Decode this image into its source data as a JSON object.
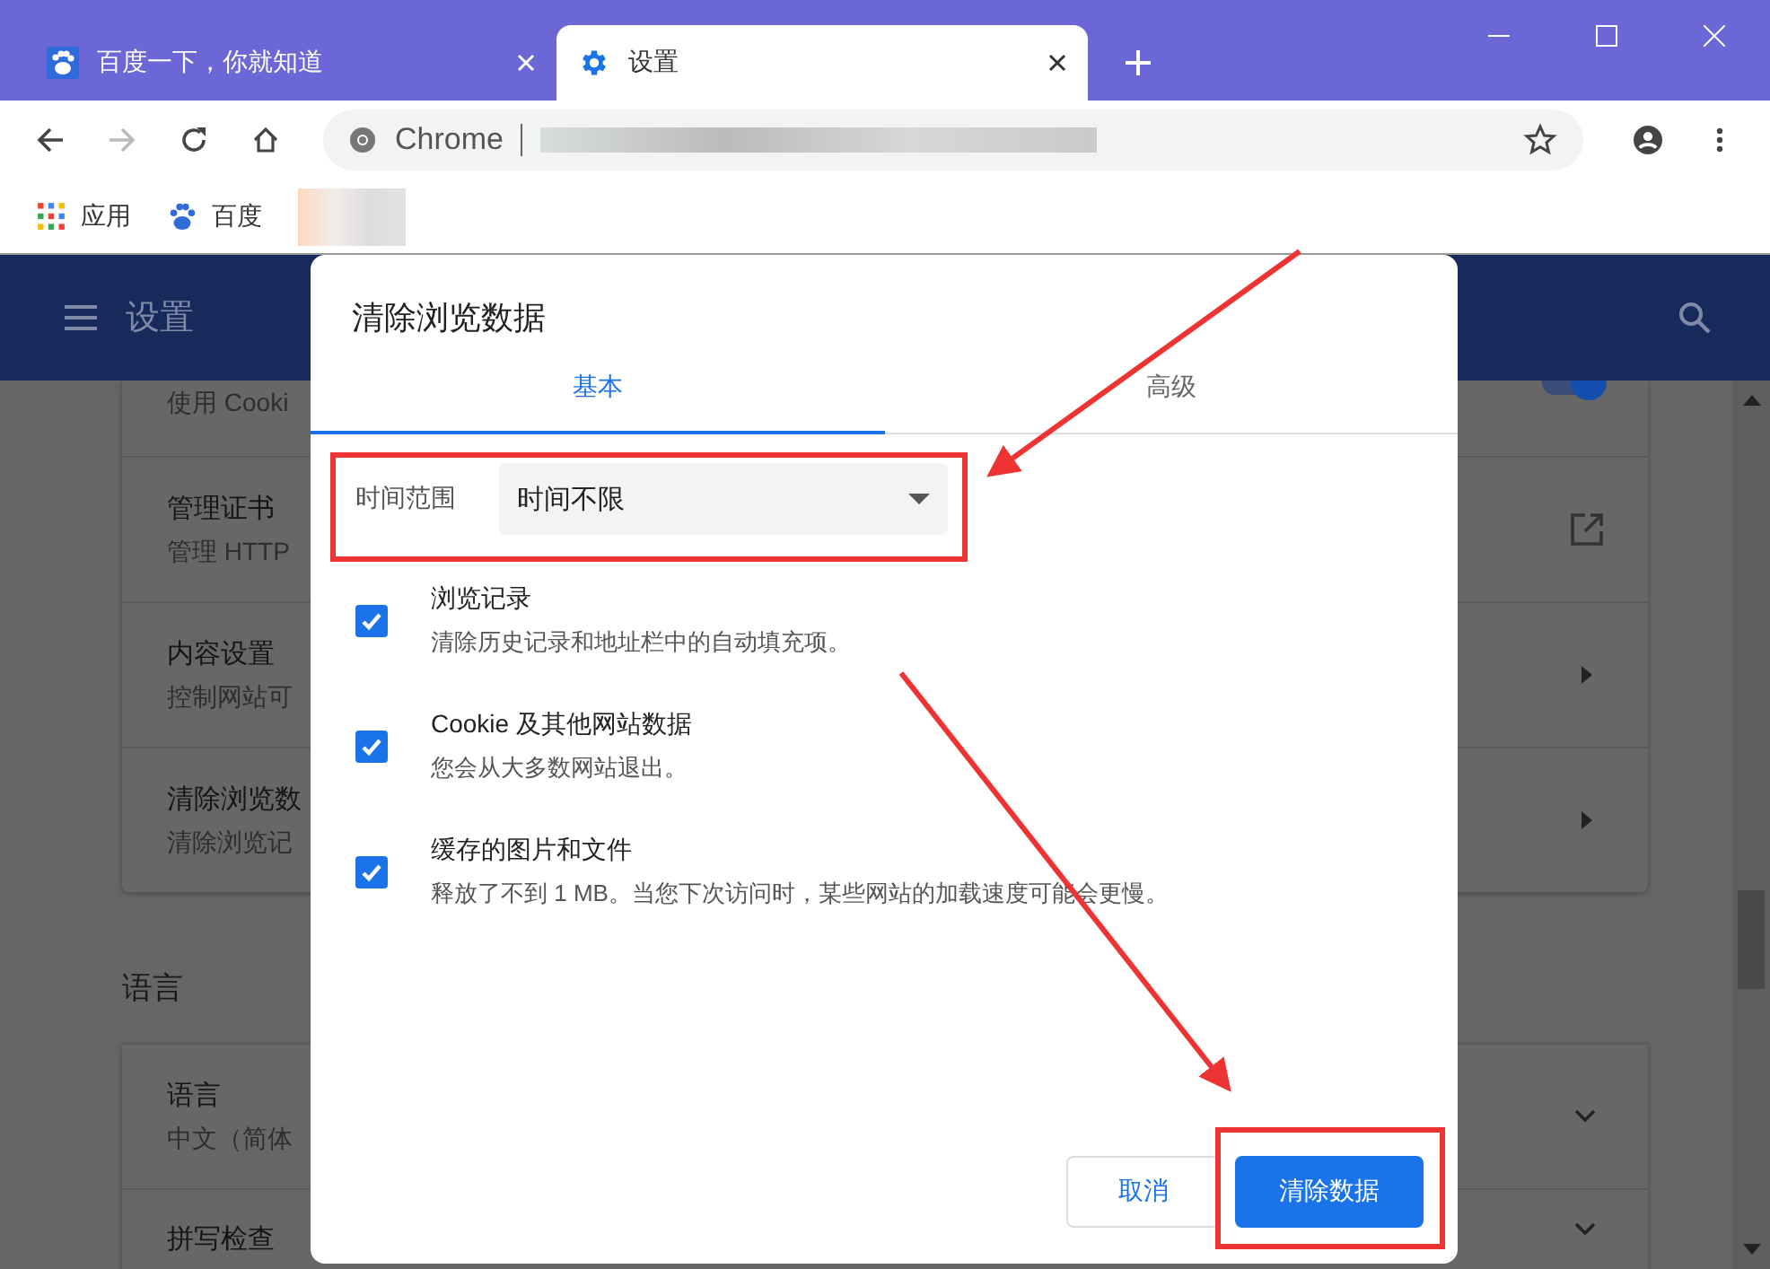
{
  "tabs": [
    {
      "title": "百度一下，你就知道",
      "kind": "paw",
      "selected": false
    },
    {
      "title": "设置",
      "kind": "gear",
      "selected": true
    }
  ],
  "address_bar": {
    "site_label": "Chrome"
  },
  "bookmarks": [
    {
      "label": "应用",
      "kind": "apps"
    },
    {
      "label": "百度",
      "kind": "paw"
    }
  ],
  "settings_page": {
    "header_title": "设置",
    "rows": [
      {
        "lines": [
          "使用 Cooki"
        ],
        "kind": "toggle",
        "on": true
      },
      {
        "lines": [
          "管理证书",
          "管理 HTTP"
        ],
        "kind": "external"
      },
      {
        "lines": [
          "内容设置",
          "控制网站可"
        ],
        "kind": "arrow"
      },
      {
        "lines": [
          "清除浏览数",
          "清除浏览记"
        ],
        "kind": "arrow"
      }
    ],
    "language_heading": "语言",
    "language_rows": [
      {
        "lines": [
          "语言",
          "中文（简体"
        ],
        "kind": "expand"
      },
      {
        "lines": [
          "拼写检查"
        ],
        "kind": "expand"
      }
    ]
  },
  "dialog": {
    "title": "清除浏览数据",
    "tabs": [
      {
        "label": "基本",
        "selected": true
      },
      {
        "label": "高级",
        "selected": false
      }
    ],
    "time_range": {
      "label": "时间范围",
      "value": "时间不限"
    },
    "items": [
      {
        "title": "浏览记录",
        "description": "清除历史记录和地址栏中的自动填充项。",
        "checked": true
      },
      {
        "title": "Cookie 及其他网站数据",
        "description": "您会从大多数网站退出。",
        "checked": true
      },
      {
        "title": "缓存的图片和文件",
        "description": "释放了不到 1 MB。当您下次访问时，某些网站的加载速度可能会更慢。",
        "checked": true
      }
    ],
    "buttons": [
      {
        "label": "取消",
        "kind": "secondary"
      },
      {
        "label": "清除数据",
        "kind": "primary"
      }
    ]
  }
}
